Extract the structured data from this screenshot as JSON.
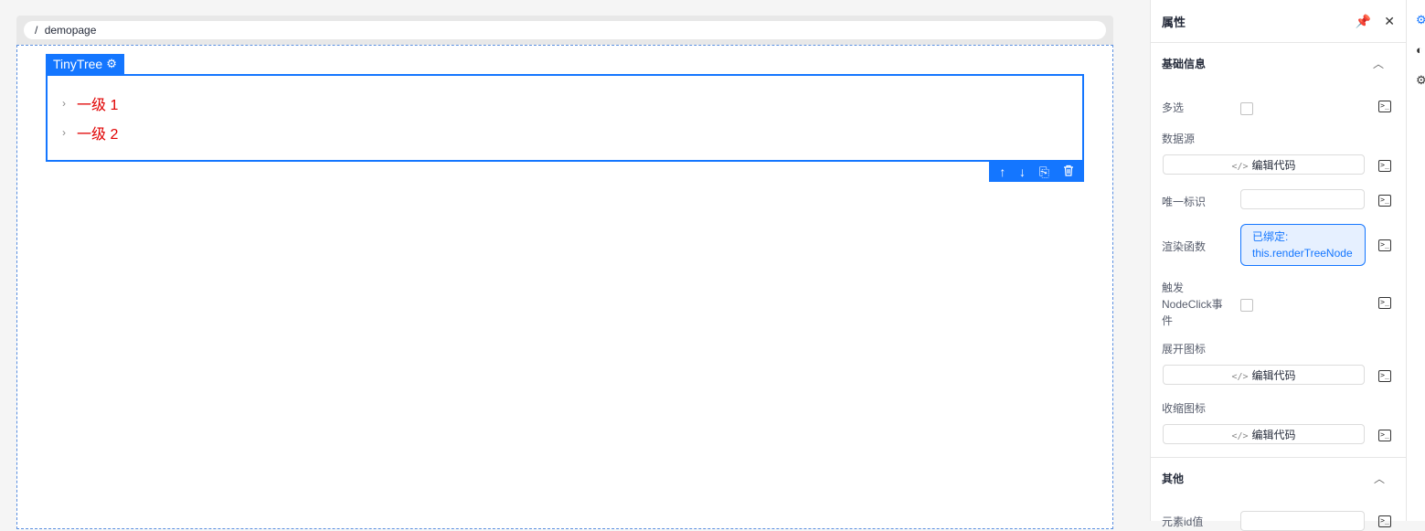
{
  "breadcrumb": {
    "separator": "/",
    "page": "demopage"
  },
  "component": {
    "name": "TinyTree",
    "settings_icon": "gear-icon",
    "nodes": [
      {
        "chevron": "›",
        "label": "一级 1"
      },
      {
        "chevron": "›",
        "label": "一级 2"
      }
    ],
    "actions": [
      {
        "icon": "arrow-up-icon",
        "glyph": "↑"
      },
      {
        "icon": "arrow-down-icon",
        "glyph": "↓"
      },
      {
        "icon": "copy-icon",
        "glyph": "⎘"
      },
      {
        "icon": "delete-icon",
        "glyph": "🗑"
      }
    ]
  },
  "panel": {
    "title": "属性",
    "pin_icon": "pin-icon",
    "close_icon": "close-icon",
    "sections": {
      "basic": {
        "title": "基础信息",
        "collapse_glyph": "︿"
      },
      "other": {
        "title": "其他",
        "collapse_glyph": "︿"
      }
    },
    "props": {
      "multiselect": "多选",
      "datasource": "数据源",
      "edit_code": "编辑代码",
      "code_glyph": "</>",
      "unique_id": "唯一标识",
      "render_fn": "渲染函数",
      "bound_label": "已绑定:",
      "bound_value": "this.renderTreeNode",
      "node_click_1": "触发",
      "node_click_2": "NodeClick事",
      "node_click_3": "件",
      "expand_icon": "展开图标",
      "collapse_icon": "收缩图标",
      "element_id": "元素id值"
    },
    "terminal_glyph": ">_"
  },
  "colors": {
    "accent": "#1476ff",
    "tree_text": "#e00000"
  }
}
